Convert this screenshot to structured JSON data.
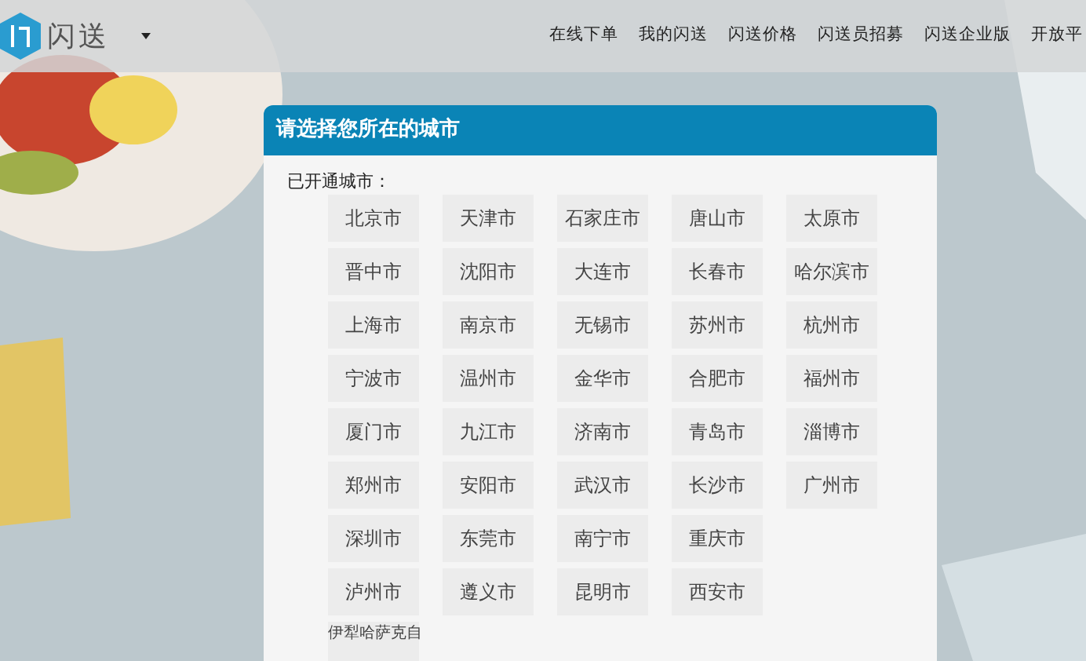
{
  "header": {
    "logo_text": "闪送",
    "nav": [
      {
        "label": "在线下单"
      },
      {
        "label": "我的闪送"
      },
      {
        "label": "闪送价格"
      },
      {
        "label": "闪送员招募"
      },
      {
        "label": "闪送企业版"
      },
      {
        "label": "开放平"
      }
    ]
  },
  "panel": {
    "title": "请选择您所在的城市",
    "label": "已开通城市：",
    "rows": [
      [
        {
          "name": "北京市",
          "kind": "city"
        },
        {
          "name": "天津市",
          "kind": "city"
        },
        {
          "name": "石家庄市",
          "kind": "city"
        },
        {
          "name": "唐山市",
          "kind": "city"
        },
        {
          "name": "太原市",
          "kind": "city"
        }
      ],
      [
        {
          "name": "晋中市",
          "kind": "city"
        },
        {
          "name": "沈阳市",
          "kind": "city"
        },
        {
          "name": "大连市",
          "kind": "city"
        },
        {
          "name": "长春市",
          "kind": "city"
        },
        {
          "name": "哈尔滨市",
          "kind": "city"
        }
      ],
      [
        {
          "name": "上海市",
          "kind": "city"
        },
        {
          "name": "南京市",
          "kind": "city"
        },
        {
          "name": "无锡市",
          "kind": "city"
        },
        {
          "name": "苏州市",
          "kind": "city"
        },
        {
          "name": "杭州市",
          "kind": "city"
        }
      ],
      [
        {
          "name": "宁波市",
          "kind": "city"
        },
        {
          "name": "温州市",
          "kind": "city"
        },
        {
          "name": "金华市",
          "kind": "city"
        },
        {
          "name": "合肥市",
          "kind": "city"
        },
        {
          "name": "福州市",
          "kind": "city"
        }
      ],
      [
        {
          "name": "厦门市",
          "kind": "city"
        },
        {
          "name": "九江市",
          "kind": "city"
        },
        {
          "name": "济南市",
          "kind": "city"
        },
        {
          "name": "青岛市",
          "kind": "city"
        },
        {
          "name": "淄博市",
          "kind": "city"
        }
      ],
      [
        {
          "name": "郑州市",
          "kind": "city"
        },
        {
          "name": "安阳市",
          "kind": "city"
        },
        {
          "name": "武汉市",
          "kind": "city"
        },
        {
          "name": "长沙市",
          "kind": "city"
        },
        {
          "name": "广州市",
          "kind": "city"
        }
      ],
      [
        {
          "name": "深圳市",
          "kind": "city"
        },
        {
          "name": "东莞市",
          "kind": "city"
        },
        {
          "name": "南宁市",
          "kind": "city"
        },
        {
          "name": "重庆市",
          "kind": "city"
        }
      ],
      [
        {
          "name": "泸州市",
          "kind": "city"
        },
        {
          "name": "遵义市",
          "kind": "city"
        },
        {
          "name": "昆明市",
          "kind": "city"
        },
        {
          "name": "西安市",
          "kind": "city"
        }
      ],
      [
        {
          "name": "伊犁哈萨克自",
          "kind": "long_city"
        }
      ]
    ]
  }
}
